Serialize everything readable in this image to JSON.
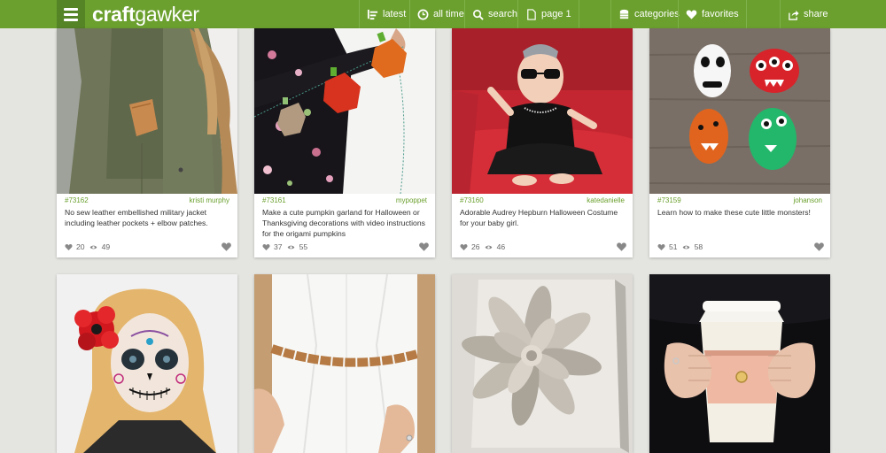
{
  "header": {
    "logo_part1": "craft",
    "logo_part2": "gawker",
    "nav": {
      "latest": "latest",
      "all_time": "all time",
      "search": "search",
      "page": "page 1",
      "categories": "categories",
      "favorites": "favorites",
      "share": "share"
    },
    "accent": "#6ba02e"
  },
  "cards": [
    {
      "id": "#73162",
      "author": "kristi murphy",
      "desc": "No sew leather embellished military jacket including leather pockets + elbow patches.",
      "likes": "20",
      "views": "49"
    },
    {
      "id": "#73161",
      "author": "mypoppet",
      "desc": "Make a cute pumpkin garland for Halloween or Thanksgiving decorations with video instructions for the origami pumpkins",
      "likes": "37",
      "views": "55"
    },
    {
      "id": "#73160",
      "author": "katedanielle",
      "desc": "Adorable Audrey Hepburn Halloween Costume for your baby girl.",
      "likes": "26",
      "views": "46"
    },
    {
      "id": "#73159",
      "author": "johanson",
      "desc": "Learn how to make these cute little monsters!",
      "likes": "51",
      "views": "58"
    }
  ]
}
